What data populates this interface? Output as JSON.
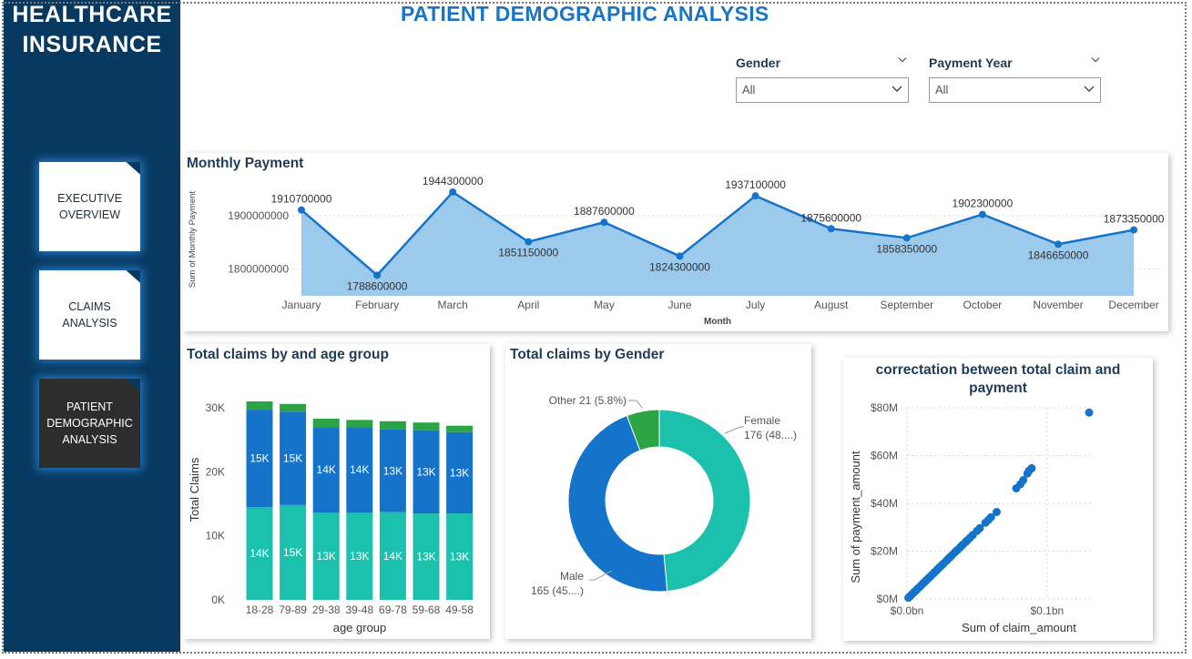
{
  "sidebar": {
    "brand_line1": "HEALTHCARE",
    "brand_line2": "INSURANCE",
    "nav": [
      {
        "line1": "EXECUTIVE",
        "line2": "OVERVIEW",
        "line3": ""
      },
      {
        "line1": "CLAIMS",
        "line2": "ANALYSIS",
        "line3": ""
      },
      {
        "line1": "PATIENT",
        "line2": "DEMOGRAPHIC",
        "line3": "ANALYSIS"
      }
    ]
  },
  "header": {
    "title": "PATIENT DEMOGRAPHIC ANALYSIS"
  },
  "filters": {
    "gender": {
      "label": "Gender",
      "value": "All"
    },
    "payment_year": {
      "label": "Payment Year",
      "value": "All"
    }
  },
  "colors": {
    "sidebar": "#083a61",
    "title": "#1b74c4",
    "teal": "#1cc1ad",
    "blue": "#1574c9",
    "green": "#2ca446",
    "area": "#9ccaed"
  },
  "chart_data": [
    {
      "id": "monthly",
      "type": "area",
      "title": "Monthly Payment",
      "xlabel": "Month",
      "ylabel": "Sum of Monthly Payment",
      "categories": [
        "January",
        "February",
        "March",
        "April",
        "May",
        "June",
        "July",
        "August",
        "September",
        "October",
        "November",
        "December"
      ],
      "values": [
        1910700000,
        1788600000,
        1944300000,
        1851150000,
        1887600000,
        1824300000,
        1937100000,
        1875600000,
        1858350000,
        1902300000,
        1846650000,
        1873350000
      ],
      "yticks": [
        "1800000000",
        "1900000000"
      ],
      "ylim": [
        1750000000,
        1980000000
      ],
      "grid": true
    },
    {
      "id": "age",
      "type": "bar",
      "title": "Total claims by and age group",
      "xlabel": "age group",
      "ylabel": "Total Claims",
      "categories": [
        "18-28",
        "79-89",
        "29-38",
        "39-48",
        "69-78",
        "59-68",
        "49-58"
      ],
      "series": [
        {
          "values": [
            14500,
            14800,
            13600,
            13600,
            13700,
            13500,
            13500
          ],
          "labels": [
            "14K",
            "15K",
            "13K",
            "13K",
            "14K",
            "13K",
            "13K"
          ]
        },
        {
          "values": [
            15200,
            14600,
            13400,
            13400,
            12900,
            13000,
            12700
          ],
          "labels": [
            "15K",
            "15K",
            "14K",
            "14K",
            "13K",
            "13K",
            "13K"
          ]
        },
        {
          "values": [
            1300,
            1200,
            1300,
            1100,
            1300,
            1200,
            1000
          ],
          "labels": [
            "",
            "",
            "",
            "",
            "",
            "",
            ""
          ]
        }
      ],
      "yticks": [
        "0K",
        "10K",
        "20K",
        "30K"
      ],
      "ylim": [
        0,
        30000
      ]
    },
    {
      "id": "gender",
      "type": "pie",
      "title": "Total claims by Gender",
      "slices": [
        {
          "name": "Female",
          "value": 176,
          "label_a": "Female",
          "label_b": "176 (48....)"
        },
        {
          "name": "Male",
          "value": 165,
          "label_a": "Male",
          "label_b": "165 (45....)"
        },
        {
          "name": "Other",
          "value": 21,
          "label_a": "Other 21 (5.8%)",
          "label_b": ""
        }
      ]
    },
    {
      "id": "scatter",
      "type": "scatter",
      "title_line1": "correctation between total claim and",
      "title_line2": "payment",
      "xlabel": "Sum of claim_amount",
      "ylabel": "Sum of payment_amount",
      "xticks": [
        "$0.0bn",
        "$0.1bn"
      ],
      "yticks": [
        "$0M",
        "$20M",
        "$40M",
        "$60M",
        "$80M"
      ],
      "xlim": [
        0,
        0.13
      ],
      "ylim": [
        0,
        80
      ],
      "points": [
        [
          0.001,
          0.5
        ],
        [
          0.002,
          1
        ],
        [
          0.003,
          1.6
        ],
        [
          0.004,
          2.2
        ],
        [
          0.005,
          2.8
        ],
        [
          0.006,
          3.3
        ],
        [
          0.007,
          3.9
        ],
        [
          0.008,
          4.5
        ],
        [
          0.009,
          5
        ],
        [
          0.01,
          5.6
        ],
        [
          0.011,
          6.2
        ],
        [
          0.012,
          6.8
        ],
        [
          0.013,
          7.3
        ],
        [
          0.014,
          7.9
        ],
        [
          0.015,
          8.5
        ],
        [
          0.016,
          9
        ],
        [
          0.017,
          9.6
        ],
        [
          0.018,
          10.2
        ],
        [
          0.019,
          10.8
        ],
        [
          0.02,
          11.3
        ],
        [
          0.021,
          11.9
        ],
        [
          0.022,
          12.5
        ],
        [
          0.023,
          13.1
        ],
        [
          0.024,
          13.6
        ],
        [
          0.025,
          14.2
        ],
        [
          0.026,
          14.8
        ],
        [
          0.028,
          15.9
        ],
        [
          0.029,
          16.5
        ],
        [
          0.03,
          17.1
        ],
        [
          0.031,
          17.6
        ],
        [
          0.032,
          18.2
        ],
        [
          0.034,
          19.4
        ],
        [
          0.035,
          20
        ],
        [
          0.036,
          20.5
        ],
        [
          0.038,
          21.6
        ],
        [
          0.039,
          22.2
        ],
        [
          0.04,
          22.8
        ],
        [
          0.042,
          23.9
        ],
        [
          0.043,
          24.5
        ],
        [
          0.045,
          25.6
        ],
        [
          0.047,
          26.8
        ],
        [
          0.05,
          28.5
        ],
        [
          0.052,
          29.6
        ],
        [
          0.056,
          31.9
        ],
        [
          0.058,
          33
        ],
        [
          0.06,
          34.2
        ],
        [
          0.064,
          36.4
        ],
        [
          0.078,
          46.3
        ],
        [
          0.081,
          48
        ],
        [
          0.083,
          49.7
        ],
        [
          0.086,
          52.5
        ],
        [
          0.087,
          53.6
        ],
        [
          0.089,
          54.7
        ],
        [
          0.13,
          78
        ]
      ]
    }
  ]
}
